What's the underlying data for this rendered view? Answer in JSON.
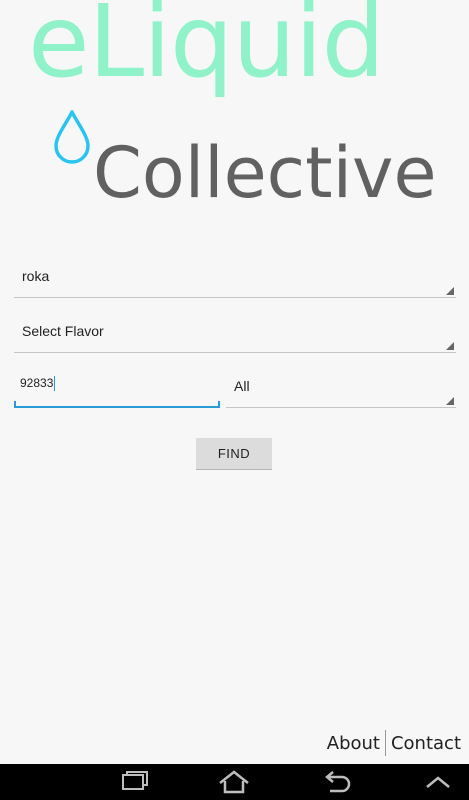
{
  "logo": {
    "top_text": "eLiquid",
    "bottom_text": "Collective",
    "top_color": "#8ff2c9",
    "bottom_color": "#616161",
    "drop_color": "#29c4f0",
    "icon": "water-drop-icon"
  },
  "form": {
    "brand_value": "roka",
    "flavor_value": "Select Flavor",
    "zip_value": "92833",
    "range_value": "All",
    "find_label": "FIND",
    "accent_color": "#2a9bd8"
  },
  "footer": {
    "about_label": "About",
    "contact_label": "Contact"
  },
  "nav_bar": {
    "icons": [
      "recent-apps-icon",
      "home-icon",
      "back-icon",
      "up-chevron-icon"
    ]
  }
}
